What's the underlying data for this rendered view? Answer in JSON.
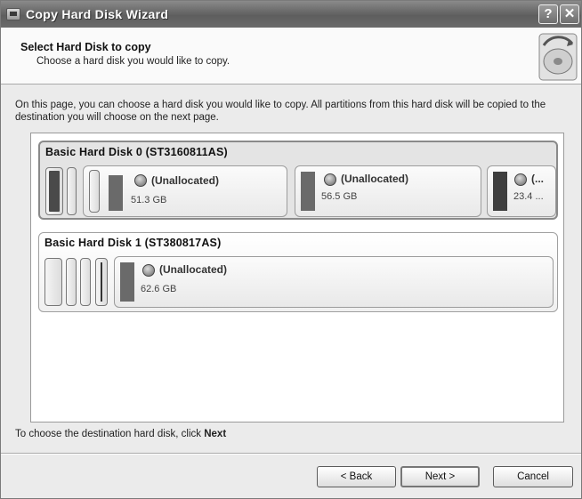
{
  "window": {
    "title": "Copy Hard Disk Wizard",
    "help_button": "?",
    "close_button": "✕"
  },
  "header": {
    "title": "Select Hard Disk to copy",
    "subtitle": "Choose a hard disk you would like to copy."
  },
  "description": "On this page, you can choose a hard disk you would like to copy. All partitions from this hard disk will be copied to the destination you will choose on the next page.",
  "disks": [
    {
      "title": "Basic Hard Disk 0 (ST3160811AS)",
      "selected": true,
      "partitions": [
        {
          "label": "(Unallocated)",
          "size": "51.3 GB"
        },
        {
          "label": "(Unallocated)",
          "size": "56.5 GB"
        },
        {
          "label": "(...",
          "size": "23.4 ..."
        }
      ]
    },
    {
      "title": "Basic Hard Disk 1 (ST380817AS)",
      "selected": false,
      "partitions": [
        {
          "label": "(Unallocated)",
          "size": "62.6 GB"
        }
      ]
    }
  ],
  "footer": {
    "instruction_prefix": "To choose the destination hard disk, click ",
    "instruction_emphasis": "Next"
  },
  "buttons": {
    "back": "< Back",
    "next": "Next >",
    "cancel": "Cancel"
  }
}
